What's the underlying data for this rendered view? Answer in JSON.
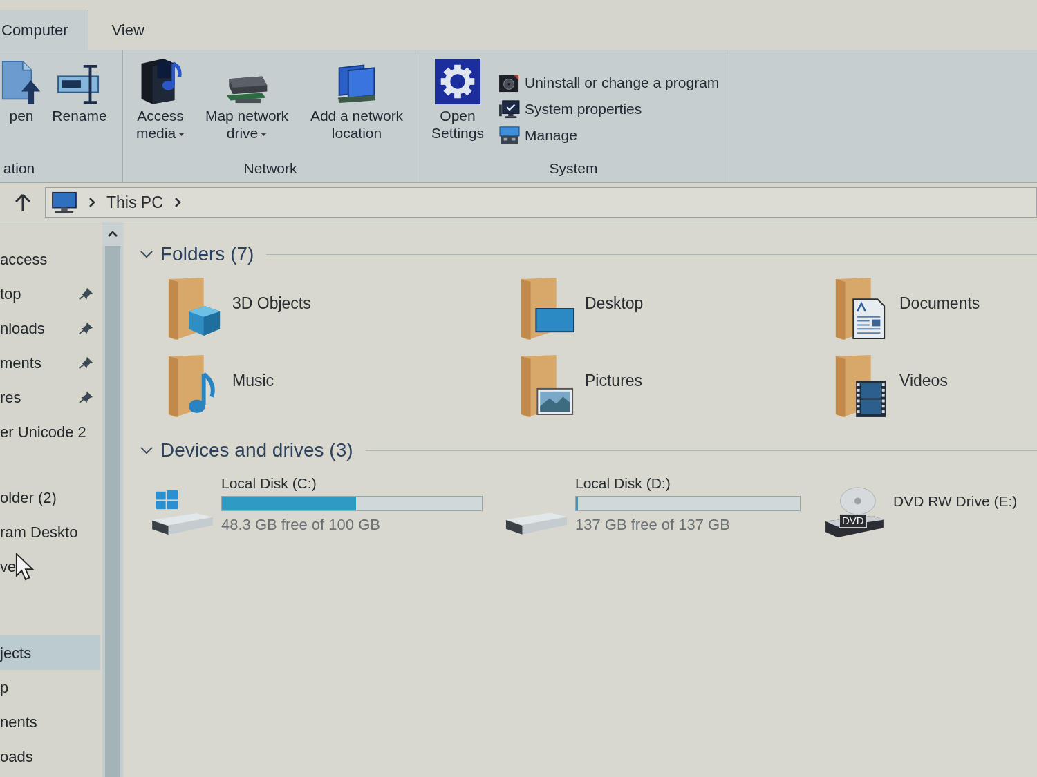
{
  "ribbon_tabs": [
    {
      "label": "Computer",
      "selected": true
    },
    {
      "label": "View",
      "selected": false
    }
  ],
  "ribbon_groups": [
    {
      "label": "ation",
      "large_buttons": [
        {
          "label": "pen",
          "dropdown": false
        },
        {
          "label": "Rename",
          "dropdown": false
        }
      ]
    },
    {
      "label": "Network",
      "large_buttons": [
        {
          "label": "Access media",
          "dropdown": true
        },
        {
          "label": "Map network drive",
          "dropdown": true
        },
        {
          "label": "Add a network location",
          "dropdown": false
        }
      ]
    },
    {
      "label": "System",
      "large_buttons": [
        {
          "label": "Open Settings",
          "dropdown": false
        }
      ],
      "small_buttons": [
        {
          "label": "Uninstall or change a program"
        },
        {
          "label": "System properties"
        },
        {
          "label": "Manage"
        }
      ]
    }
  ],
  "address_bar": {
    "path": [
      "This PC"
    ]
  },
  "nav_pane": {
    "groups": [
      {
        "items": [
          {
            "label": "access",
            "pinned": false,
            "selected": false
          },
          {
            "label": "top",
            "pinned": true,
            "selected": false
          },
          {
            "label": "nloads",
            "pinned": true,
            "selected": false
          },
          {
            "label": "ments",
            "pinned": true,
            "selected": false
          },
          {
            "label": "res",
            "pinned": true,
            "selected": false
          },
          {
            "label": "er Unicode 2",
            "pinned": false,
            "selected": false
          }
        ]
      },
      {
        "items": [
          {
            "label": "older (2)",
            "pinned": false,
            "selected": false
          },
          {
            "label": "ram Deskto",
            "pinned": false,
            "selected": false
          },
          {
            "label": "ve",
            "pinned": false,
            "selected": false
          }
        ]
      },
      {
        "items": [
          {
            "label": "jects",
            "pinned": false,
            "selected": true
          },
          {
            "label": "p",
            "pinned": false,
            "selected": false
          },
          {
            "label": "nents",
            "pinned": false,
            "selected": false
          },
          {
            "label": "oads",
            "pinned": false,
            "selected": false
          }
        ]
      }
    ]
  },
  "sections": [
    {
      "title": "Folders (7)",
      "expanded": true,
      "folders": [
        {
          "name": "3D Objects"
        },
        {
          "name": "Desktop"
        },
        {
          "name": "Documents"
        },
        {
          "name": "Music"
        },
        {
          "name": "Pictures"
        },
        {
          "name": "Videos"
        }
      ]
    },
    {
      "title": "Devices and drives (3)",
      "expanded": true,
      "drives": [
        {
          "kind": "system",
          "name": "Local Disk (C:)",
          "level": 0.517,
          "info": "48.3 GB free of 100 GB"
        },
        {
          "kind": "disk",
          "name": "Local Disk (D:)",
          "level": 0.01,
          "info": "137 GB free of 137 GB"
        },
        {
          "kind": "optical",
          "name": "DVD RW Drive (E:)",
          "icon_label": "DVD"
        }
      ]
    }
  ]
}
